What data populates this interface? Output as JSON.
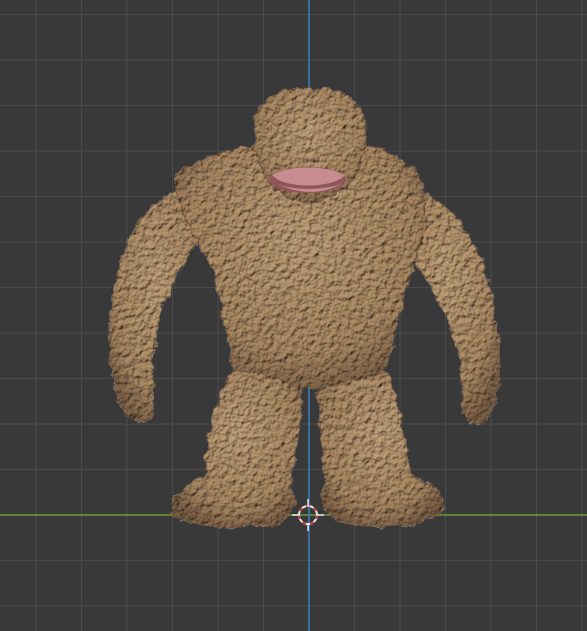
{
  "viewport": {
    "background_color": "#393939",
    "grid_line_color": "#4a4a4a",
    "x_axis_color": "#6c9a3c",
    "z_axis_color": "#3f7dc0"
  },
  "model": {
    "description_icon": "clay-golem-model",
    "skin_color": "#b08d66",
    "skin_shadow_color": "#7d6046",
    "skin_highlight_color": "#c6a47c",
    "mouth_color": "#c78c8f",
    "mouth_inner_color": "#8f5558"
  },
  "cursor": {
    "icon": "3d-cursor-icon",
    "ring_color": "#e8e8e8",
    "ring_dash_color": "#c43a3a"
  }
}
